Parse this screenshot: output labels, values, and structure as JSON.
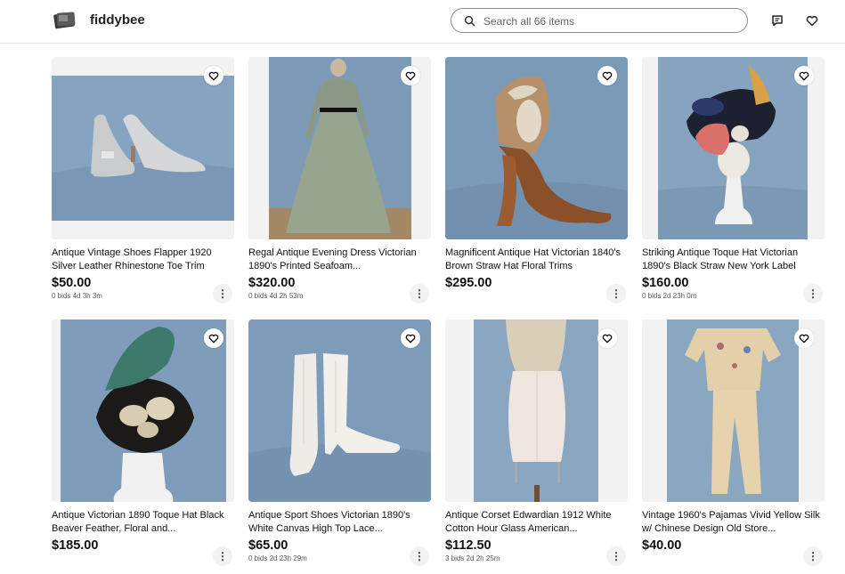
{
  "store": {
    "name": "fiddybee"
  },
  "search": {
    "placeholder": "Search all 66 items"
  },
  "listings": [
    {
      "title": "Antique Vintage Shoes Flapper 1920 Silver Leather Rhinestone Toe Trim",
      "price": "$50.00",
      "bids": "0 bids 4d 3h 3m"
    },
    {
      "title": "Regal Antique Evening Dress Victorian 1890's Printed Seafoam...",
      "price": "$320.00",
      "bids": "0 bids 4d 2h 53m"
    },
    {
      "title": "Magnificent Antique Hat Victorian 1840's Brown Straw Hat Floral Trims",
      "price": "$295.00",
      "bids": ""
    },
    {
      "title": "Striking Antique Toque Hat Victorian 1890's Black Straw New York Label",
      "price": "$160.00",
      "bids": "0 bids 2d 23h 0m"
    },
    {
      "title": "Antique Victorian 1890 Toque Hat Black Beaver Feather, Floral and...",
      "price": "$185.00",
      "bids": ""
    },
    {
      "title": "Antique Sport Shoes Victorian 1890's White Canvas High Top Lace...",
      "price": "$65.00",
      "bids": "0 bids 2d 23h 29m"
    },
    {
      "title": "Antique Corset Edwardian 1912 White Cotton Hour Glass American...",
      "price": "$112.50",
      "bids": "3 bids 2d 2h 25m"
    },
    {
      "title": "Vintage 1960's Pajamas Vivid Yellow Silk w/ Chinese Design Old Store...",
      "price": "$40.00",
      "bids": ""
    }
  ],
  "colors": {
    "backdrop_blue": "#7f9fbd",
    "header_border": "#e6e6e6"
  }
}
